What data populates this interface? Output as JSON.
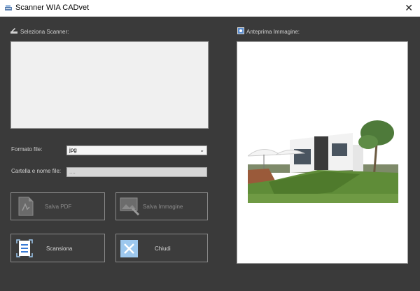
{
  "window": {
    "title": "Scanner WIA CADvet",
    "close_glyph": "✕"
  },
  "left": {
    "scanner_header": "Seleziona Scanner:",
    "format_label": "Formato file:",
    "format_value": "jpg",
    "path_label": "Cartella e nome file:",
    "path_placeholder": "....",
    "buttons": {
      "save_pdf": "Salva PDF",
      "save_image": "Salva Immagine",
      "scan": "Scansiona",
      "close": "Chiudi"
    }
  },
  "right": {
    "preview_header": "Anteprima Immagine:"
  },
  "icons": {
    "app": "scanner-icon",
    "scanner_header": "scanner-icon",
    "preview_header": "image-icon",
    "save_pdf": "pdf-document-icon",
    "save_image": "image-hand-icon",
    "scan": "scan-document-icon",
    "close": "close-icon"
  },
  "colors": {
    "close_button_bg": "#9dc8ee",
    "accent_blue": "#3a7bd5"
  }
}
